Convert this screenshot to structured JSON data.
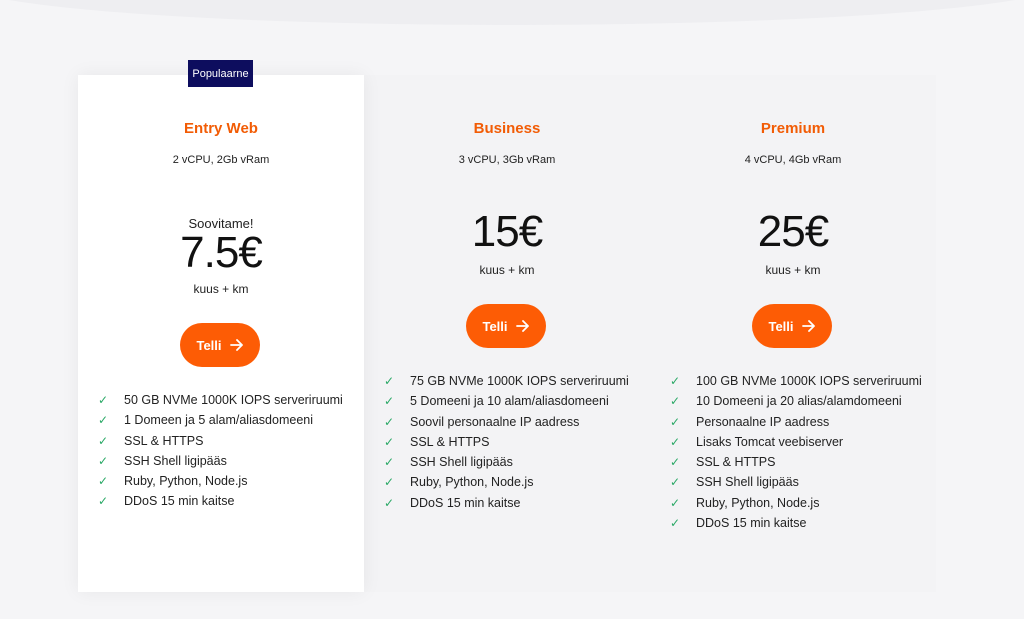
{
  "badge": "Populaarne",
  "plans": [
    {
      "title": "Entry Web",
      "spec": "2 vCPU, 2Gb vRam",
      "note": "Soovitame!",
      "price": "7.5€",
      "period": "kuus + km",
      "button": "Telli",
      "features": [
        "50 GB NVMe 1000K IOPS serveriruumi",
        "1 Domeen ja 5 alam/aliasdomeeni",
        "SSL & HTTPS",
        "SSH Shell ligipääs",
        "Ruby, Python, Node.js",
        "DDoS 15 min kaitse"
      ]
    },
    {
      "title": "Business",
      "spec": "3 vCPU, 3Gb vRam",
      "price": "15€",
      "period": "kuus + km",
      "button": "Telli",
      "features": [
        "75 GB NVMe 1000K IOPS serveriruumi",
        "5 Domeeni ja 10 alam/aliasdomeeni",
        "Soovil personaalne IP aadress",
        "SSL & HTTPS",
        "SSH Shell ligipääs",
        "Ruby, Python, Node.js",
        "DDoS 15 min kaitse"
      ]
    },
    {
      "title": "Premium",
      "spec": "4 vCPU, 4Gb vRam",
      "price": "25€",
      "period": "kuus + km",
      "button": "Telli",
      "features": [
        "100 GB NVMe 1000K IOPS serveriruumi",
        "10 Domeeni ja 20 alias/alamdomeeni",
        "Personaalne IP aadress",
        "Lisaks Tomcat veebiserver",
        "SSL & HTTPS",
        "SSH Shell ligipääs",
        "Ruby, Python, Node.js",
        "DDoS 15 min kaitse"
      ]
    }
  ],
  "icons": {
    "check": "check-icon",
    "arrow": "arrow-right-icon"
  },
  "colors": {
    "accent": "#fd5c05",
    "title": "#f25c05",
    "badge": "#0d0d5e",
    "check": "#2aa866"
  }
}
